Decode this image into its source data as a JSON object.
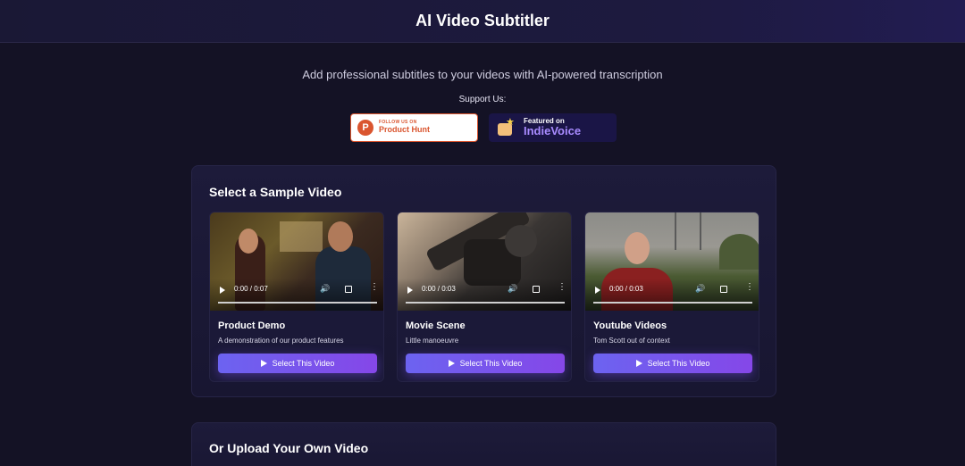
{
  "header": {
    "title": "AI Video Subtitler"
  },
  "hero": {
    "tagline": "Add professional subtitles to your videos with AI-powered transcription",
    "support_label": "Support Us:"
  },
  "badges": {
    "product_hunt": {
      "small": "FOLLOW US ON",
      "big": "Product Hunt",
      "logo_letter": "P"
    },
    "indie_voice": {
      "small": "Featured on",
      "big": "IndieVoice"
    }
  },
  "samples": {
    "title": "Select a Sample Video",
    "videos": [
      {
        "title": "Product Demo",
        "description": "A demonstration of our product features",
        "time": "0:00 / 0:07",
        "button": "Select This Video"
      },
      {
        "title": "Movie Scene",
        "description": "Little manoeuvre",
        "time": "0:00 / 0:03",
        "button": "Select This Video"
      },
      {
        "title": "Youtube Videos",
        "description": "Tom Scott out of context",
        "time": "0:00 / 0:03",
        "button": "Select This Video"
      }
    ]
  },
  "upload": {
    "title": "Or Upload Your Own Video"
  },
  "colors": {
    "accent_start": "#6c63f0",
    "accent_end": "#8547e8",
    "background": "#141225"
  }
}
